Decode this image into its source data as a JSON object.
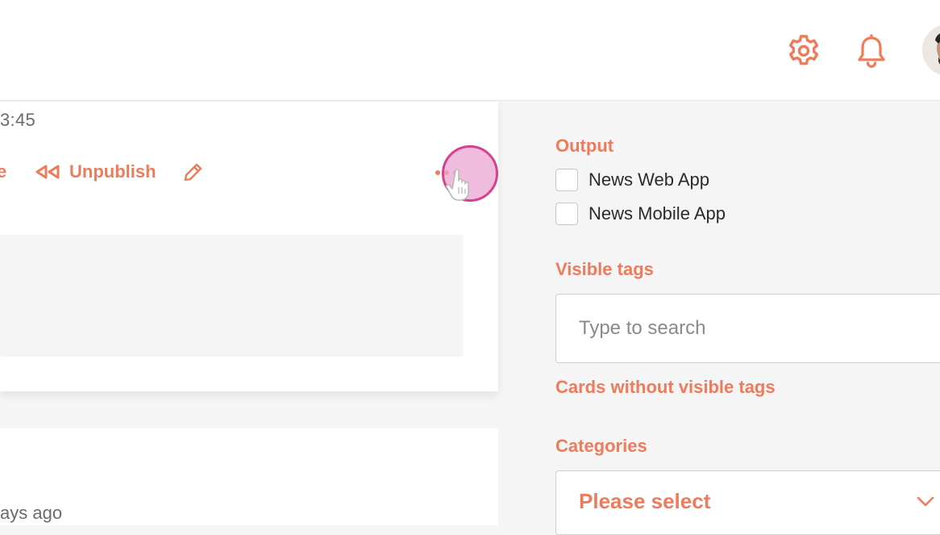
{
  "header": {
    "settings_icon": "gear-icon",
    "notifications_icon": "bell-icon",
    "avatar": "user-avatar"
  },
  "card": {
    "time": "3:45",
    "action_partial": "e",
    "unpublish_label": "Unpublish",
    "edit_icon": "pencil-icon",
    "more_icon": "more-dots-icon"
  },
  "card2": {
    "ago_text": "ays ago"
  },
  "sidebar": {
    "output_label": "Output",
    "outputs": [
      {
        "label": "News Web App",
        "checked": false
      },
      {
        "label": "News Mobile App",
        "checked": false
      }
    ],
    "visible_tags_label": "Visible tags",
    "search_placeholder": "Type to search",
    "cards_without_tags": "Cards without visible tags",
    "categories_label": "Categories",
    "categories_value": "Please select"
  },
  "colors": {
    "accent": "#ee7b5b",
    "cursor_ring": "#d4418e"
  }
}
